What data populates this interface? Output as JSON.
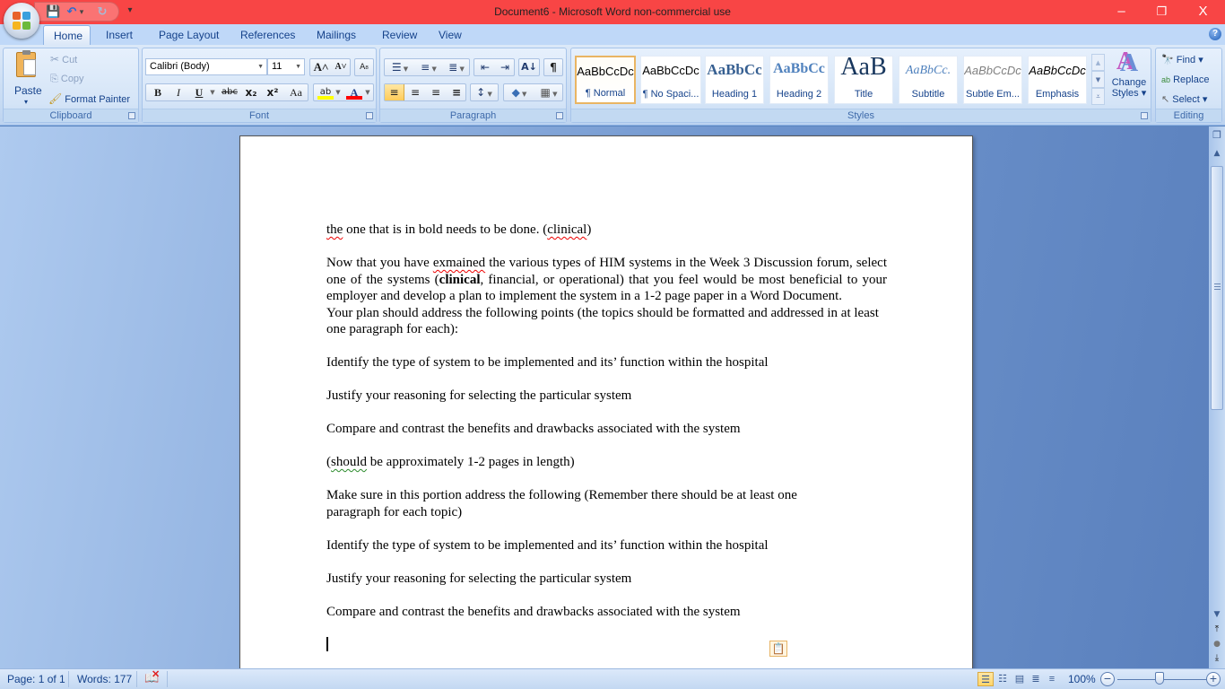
{
  "titlebar": {
    "title": "Document6 - Microsoft Word non-commercial use",
    "accent_color": "#f84545",
    "minimize": "–",
    "restore": "❐",
    "close": "X"
  },
  "qat": {
    "save_icon": "💾",
    "undo_icon": "↶",
    "undo_dropdown": "▾",
    "redo_icon": "↻",
    "customize_icon": "▾"
  },
  "tabs": [
    {
      "label": "Home",
      "active": true
    },
    {
      "label": "Insert"
    },
    {
      "label": "Page Layout"
    },
    {
      "label": "References"
    },
    {
      "label": "Mailings"
    },
    {
      "label": "Review"
    },
    {
      "label": "View"
    }
  ],
  "help_icon": "?",
  "ribbon": {
    "clipboard": {
      "label": "Clipboard",
      "paste": "Paste",
      "paste_arrow": "▾",
      "cut": "Cut",
      "copy": "Copy",
      "format_painter": "Format Painter"
    },
    "font": {
      "label": "Font",
      "font_name": "Calibri (Body)",
      "font_size": "11",
      "grow": "A˄",
      "shrink": "A˅",
      "clear": "A₈",
      "bold": "B",
      "italic": "I",
      "underline": "U",
      "strike": "abc",
      "subscript": "x₂",
      "superscript": "x²",
      "change_case": "Aa",
      "highlight": "ab",
      "font_color": "A",
      "highlight_color": "#ffff00",
      "font_color_value": "#ff0000"
    },
    "paragraph": {
      "label": "Paragraph",
      "bullets": "☰",
      "numbering": "≡",
      "multilevel": "≣",
      "decrease_indent": "⇤",
      "increase_indent": "⇥",
      "sort": "A↓",
      "show_marks": "¶",
      "align_left": "≡",
      "center": "≡",
      "align_right": "≡",
      "justify": "≡",
      "line_spacing": "↕",
      "shading": "◆",
      "borders": "▦"
    },
    "styles": {
      "label": "Styles",
      "items": [
        {
          "sample": "AaBbCcDc",
          "name": "¶ Normal",
          "active": true
        },
        {
          "sample": "AaBbCcDc",
          "name": "¶ No Spaci..."
        },
        {
          "sample": "AaBbCc",
          "name": "Heading 1"
        },
        {
          "sample": "AaBbCc",
          "name": "Heading 2"
        },
        {
          "sample": "AaB",
          "name": "Title"
        },
        {
          "sample": "AaBbCc.",
          "name": "Subtitle"
        },
        {
          "sample": "AaBbCcDc",
          "name": "Subtle Em..."
        },
        {
          "sample": "AaBbCcDc",
          "name": "Emphasis"
        }
      ],
      "change_styles": "Change Styles",
      "change_styles_l1": "Change",
      "change_styles_l2": "Styles ▾"
    },
    "editing": {
      "label": "Editing",
      "find": "Find ▾",
      "replace": "Replace",
      "select": "Select ▾"
    }
  },
  "document": {
    "line1_a": "the",
    "line1_b": " one that is in bold needs to be done. (",
    "line1_c": "clinical",
    "line1_d": ")",
    "p2_a": "Now that you have ",
    "p2_b": "exmained",
    "p2_c": " the various types of HIM systems in the Week 3 Discussion forum, select one of the systems (",
    "p2_bold": "clinical",
    "p2_d": ", financial, or operational) that you feel would be most beneficial to your employer and develop a plan to implement the system in a 1-2 page paper in a Word Document.",
    "p3": "Your plan should address the following points (the topics should be formatted and addressed in at least one paragraph for each):",
    "p4": "Identify the type of system to be implemented and its’ function within the hospital",
    "p5": "Justify your reasoning for selecting the particular system",
    "p6": "Compare and contrast the benefits and drawbacks associated with the system",
    "p7_a": "(",
    "p7_b": "should",
    "p7_c": " be approximately 1-2 pages in length)",
    "p8": "Make sure in this portion address the following (Remember there should be at least one paragraph for each topic)",
    "p9": "Identify the type of system to be implemented and its’ function within the hospital",
    "p10": "Justify your reasoning for selecting the particular system",
    "p11": "Compare and contrast the benefits and drawbacks associated with the system",
    "paste_options_icon": "📋"
  },
  "scrollbar": {
    "ruler_icon": "❐",
    "up": "▲",
    "down": "▼",
    "prev_page": "⤒",
    "select_browse": "●",
    "next_page": "⤓"
  },
  "statusbar": {
    "page": "Page: 1 of 1",
    "words": "Words: 177",
    "proofing_icon": "📖",
    "zoom": "100%",
    "zoom_out": "−",
    "zoom_in": "+",
    "zoom_level_percent": 100,
    "views": [
      "☰",
      "☷",
      "▤",
      "≣",
      "≡"
    ]
  }
}
